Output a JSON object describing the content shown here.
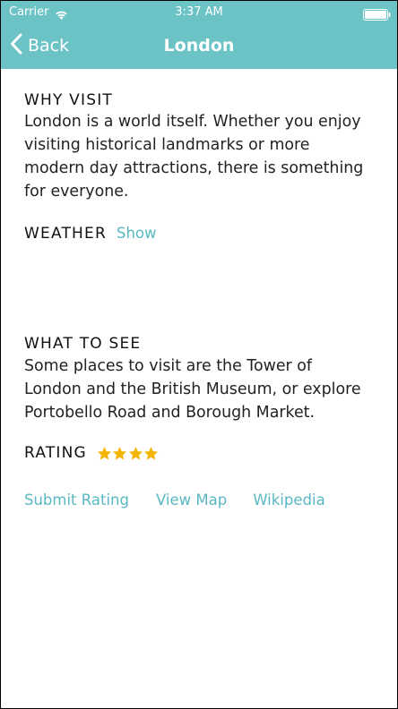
{
  "status_bar": {
    "carrier": "Carrier",
    "time": "3:37 AM"
  },
  "nav": {
    "back_label": "Back",
    "title": "London",
    "color": "#6bc3c6"
  },
  "why_visit": {
    "heading": "WHY VISIT",
    "lines": [
      "London is a world itself. Whether you enjoy",
      "visiting historical landmarks or more",
      "modern day attractions, there is something",
      "for everyone."
    ]
  },
  "weather": {
    "heading": "WEATHER",
    "show_label": "Show"
  },
  "what_to_see": {
    "heading": "WHAT TO SEE",
    "lines": [
      "Some places to visit are the Tower of",
      "London and the British Museum, or explore",
      "Portobello Road and Borough Market."
    ]
  },
  "rating": {
    "heading": "RATING",
    "stars": 4,
    "star_color": "#f5b400"
  },
  "links": {
    "submit_rating": "Submit Rating",
    "view_map": "View Map",
    "wikipedia": "Wikipedia",
    "link_color": "#5bb8c2"
  }
}
